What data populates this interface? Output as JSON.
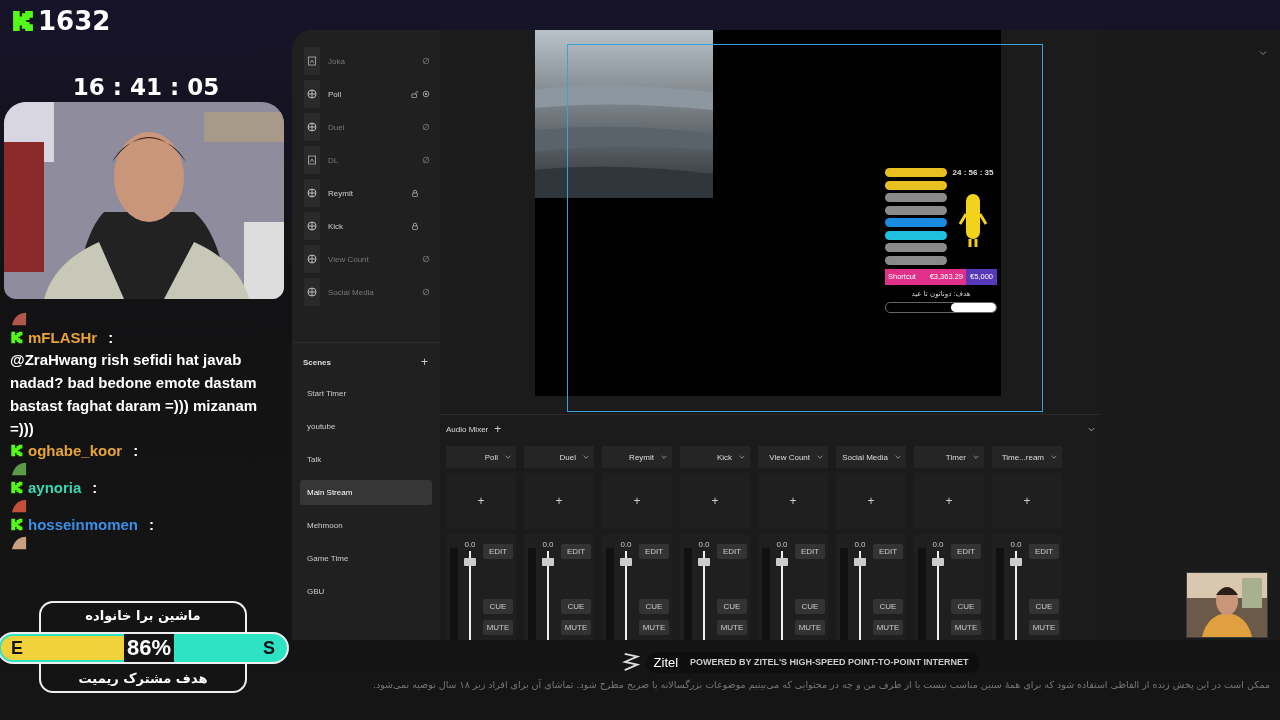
{
  "header": {
    "points": "1632",
    "clock": "16 : 41 : 05"
  },
  "chat": [
    {
      "kind": "emote",
      "color": "#b0584a"
    },
    {
      "kind": "user",
      "user": "mFLASHr",
      "color": "#e8a33a",
      "sep": ":"
    },
    {
      "kind": "text",
      "text": "@ZraHwang rish sefidi hat javab nadad? bad bedone emote dastam bastast faghat daram =))) mizanam =)))"
    },
    {
      "kind": "user",
      "user": "oghabe_koor",
      "color": "#e8a33a",
      "sep": ":"
    },
    {
      "kind": "emote",
      "color": "#5c9a4a"
    },
    {
      "kind": "user",
      "user": "aynoria",
      "color": "#3ad6b0",
      "sep": ":"
    },
    {
      "kind": "emote",
      "color": "#c0503a"
    },
    {
      "kind": "user",
      "user": "hosseinmomen",
      "color": "#3a8ee8",
      "sep": ":"
    },
    {
      "kind": "emote",
      "color": "#c8a080"
    }
  ],
  "goal": {
    "title": "ماشین برا خانواده",
    "left": "E",
    "right": "S",
    "percent": "86%",
    "level": 0.46,
    "subtitle": "هدف مشترک ریمیت"
  },
  "sources": [
    {
      "name": "Joka",
      "kind": "hidden"
    },
    {
      "name": "Poll",
      "kind": "active"
    },
    {
      "name": "Duel",
      "kind": "hidden"
    },
    {
      "name": "DL",
      "kind": "hidden"
    },
    {
      "name": "Reymit",
      "kind": "locked"
    },
    {
      "name": "Kick",
      "kind": "locked"
    },
    {
      "name": "View Count",
      "kind": "hidden"
    },
    {
      "name": "Social Media",
      "kind": "hidden"
    }
  ],
  "scenes": {
    "title": "Scenes",
    "add": "+",
    "items": [
      {
        "name": "Start Timer",
        "selected": false
      },
      {
        "name": "youtube",
        "selected": false
      },
      {
        "name": "Talk",
        "selected": false
      },
      {
        "name": "Main Stream",
        "selected": true
      },
      {
        "name": "Mehmoon",
        "selected": false
      },
      {
        "name": "Game Time",
        "selected": false
      },
      {
        "name": "GBU",
        "selected": false
      }
    ]
  },
  "preview": {
    "widget": {
      "timer": "24 : 56 : 35",
      "bars": [
        {
          "color": "#e8c020"
        },
        {
          "color": "#e8c020"
        },
        {
          "color": "#8a8a8a"
        },
        {
          "color": "#8a8a8a"
        },
        {
          "color": "#1a8ae0"
        },
        {
          "color": "#20c0e0"
        },
        {
          "color": "#8a8a8a"
        },
        {
          "color": "#8a8a8a"
        }
      ],
      "shortcut": {
        "label": "Shortcut",
        "amount": "€3,363.29",
        "target": "€5,000"
      },
      "goal_text": "هدف: دوناتون تا عید"
    }
  },
  "mixer": {
    "title": "Audio Mixer",
    "add": "+",
    "channels": [
      {
        "name": "Poll",
        "reading": "0.0",
        "level": 0.88,
        "add": "+",
        "buttons": [
          "EDIT",
          "CUE",
          "MUTE"
        ]
      },
      {
        "name": "Duel",
        "reading": "0.0",
        "level": 0.88,
        "add": "+",
        "buttons": [
          "EDIT",
          "CUE",
          "MUTE"
        ]
      },
      {
        "name": "Reymit",
        "reading": "0.0",
        "level": 0.88,
        "add": "+",
        "buttons": [
          "EDIT",
          "CUE",
          "MUTE"
        ]
      },
      {
        "name": "Kick",
        "reading": "0.0",
        "level": 0.88,
        "add": "+",
        "buttons": [
          "EDIT",
          "CUE",
          "MUTE"
        ]
      },
      {
        "name": "View Count",
        "reading": "0.0",
        "level": 0.88,
        "add": "+",
        "buttons": [
          "EDIT",
          "CUE",
          "MUTE"
        ]
      },
      {
        "name": "Social Media",
        "reading": "0.0",
        "level": 0.88,
        "add": "+",
        "buttons": [
          "EDIT",
          "CUE",
          "MUTE"
        ]
      },
      {
        "name": "Timer",
        "reading": "0.0",
        "level": 0.88,
        "add": "+",
        "buttons": [
          "EDIT",
          "CUE",
          "MUTE"
        ]
      },
      {
        "name": "Time...ream",
        "reading": "0.0",
        "level": 0.88,
        "add": "+",
        "buttons": [
          "EDIT",
          "CUE",
          "MUTE"
        ]
      }
    ]
  },
  "sponsor": {
    "name": "Zitel",
    "tagline": "POWERED BY ZITEL'S HIGH-SPEED POINT-TO-POINT INTERNET"
  },
  "disclaimer": "ممکن است در این پخش زنده از الفاظی استفاده شود که برای همهٔ سنین مناسب نیست یا از طرف من و چه در محتوایی که می‌بینیم موضوعات بزرگسالانه یا صریح مطرح شود. تماشای آن برای افراد زیر ۱۸ سال توصیه نمی‌شود."
}
